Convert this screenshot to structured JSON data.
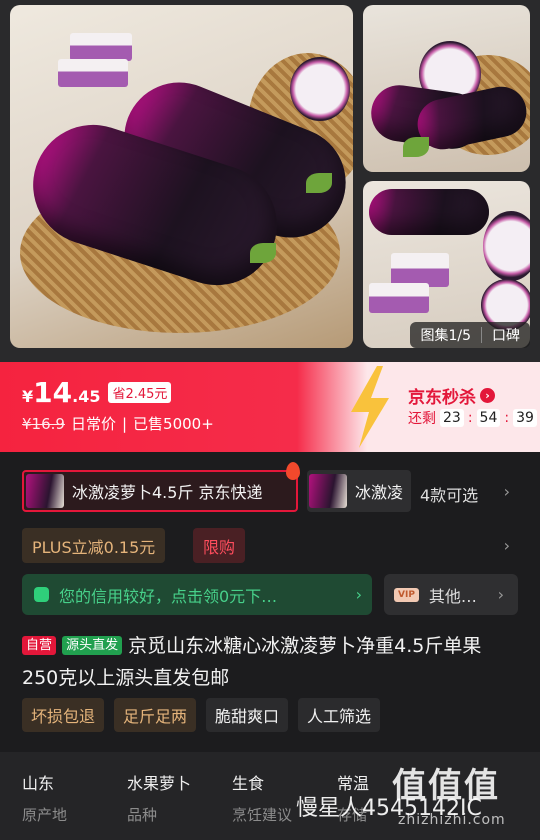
{
  "gallery": {
    "counter_label": "图集1/5",
    "reviews_label": "口碑"
  },
  "price": {
    "currency": "¥",
    "integer": "14",
    "decimal": ".45",
    "save_badge": "省2.45元",
    "original": "¥16.9",
    "original_label": "日常价",
    "sold": "已售5000+"
  },
  "flash_sale": {
    "label": "京东秒杀",
    "remaining_label": "还剩",
    "hours": "23",
    "minutes": "54",
    "seconds": "39"
  },
  "variants": {
    "selected_label": "冰激凌萝卜4.5斤 京东快递",
    "other_label": "冰激凌",
    "count_label": "4款可选"
  },
  "promo": {
    "plus_label": "PLUS立减0.15元",
    "limit_label": "限购"
  },
  "credit": {
    "label": "您的信用较好，点击领0元下…",
    "other_label": "其他…",
    "vip_badge": "VIP"
  },
  "product": {
    "tag_self": "自营",
    "tag_source": "源头直发",
    "title": "京觅山东冰糖心冰激凌萝卜净重4.5斤单果250克以上源头直发包邮"
  },
  "features": [
    "坏损包退",
    "足斤足两",
    "脆甜爽口",
    "人工筛选"
  ],
  "specs": [
    {
      "value": "山东",
      "key": "原产地"
    },
    {
      "value": "水果萝卜",
      "key": "品种"
    },
    {
      "value": "生食",
      "key": "烹饪建议"
    },
    {
      "value": "常温",
      "key": "存储"
    }
  ],
  "watermark": {
    "user": "慢星人4545142IC",
    "logo": "值值值",
    "url": "zhizhizhi.com"
  },
  "colors": {
    "accent_red": "#e3173a",
    "gold": "#e5b47b",
    "credit_green": "#47d08a"
  }
}
